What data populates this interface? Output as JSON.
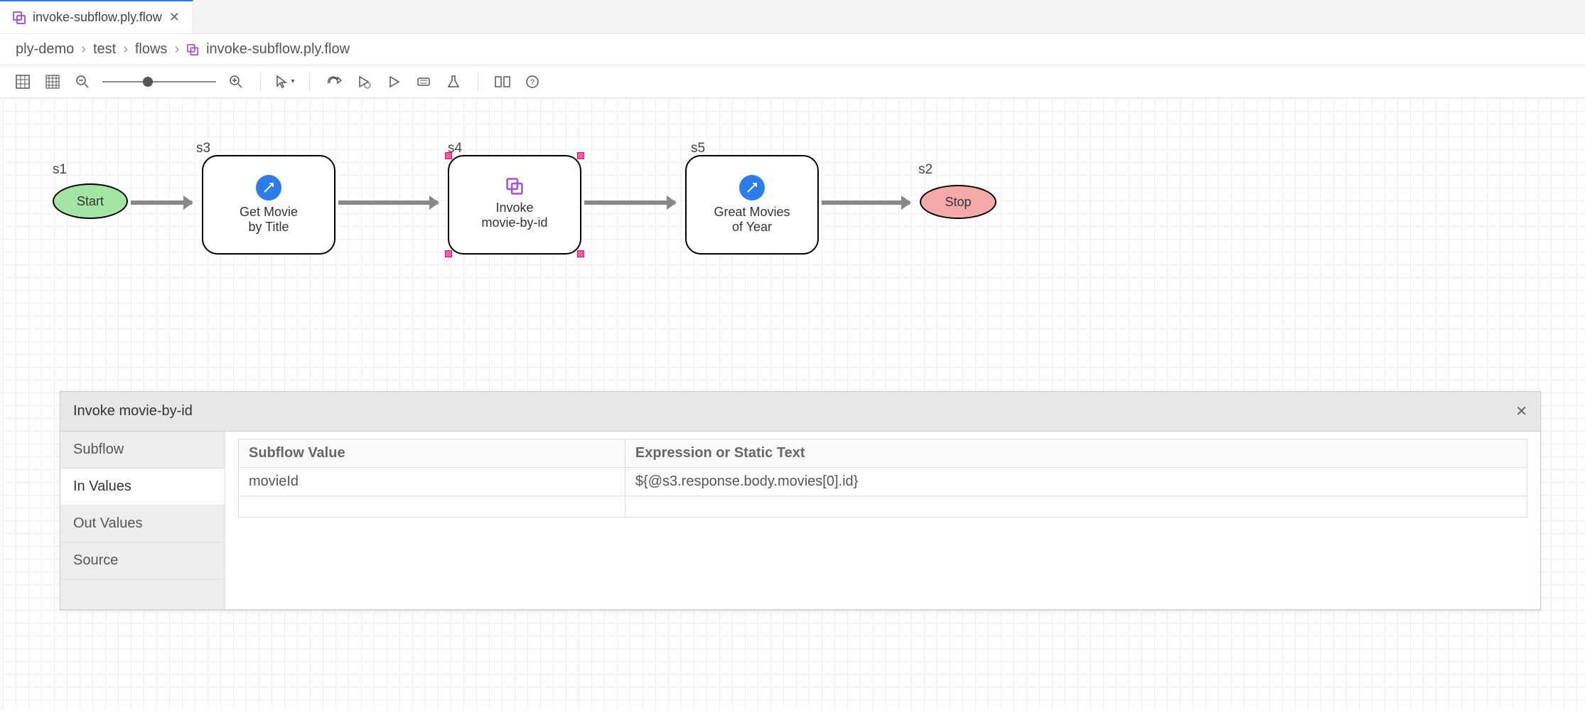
{
  "tab": {
    "title": "invoke-subflow.ply.flow"
  },
  "breadcrumb": {
    "items": [
      "ply-demo",
      "test",
      "flows",
      "invoke-subflow.ply.flow"
    ]
  },
  "toolbar": {
    "grid_btn": "grid",
    "grid_dense_btn": "grid-dense",
    "zoom_out": "zoom-out",
    "zoom_in": "zoom-in",
    "select_mode": "select",
    "redo": "redo",
    "run": "run",
    "play": "play",
    "form": "form",
    "flask": "flask",
    "compare": "compare",
    "help": "help"
  },
  "nodes": {
    "s1": {
      "id": "s1",
      "label": "Start"
    },
    "s2": {
      "id": "s2",
      "label": "Stop"
    },
    "s3": {
      "id": "s3",
      "title1": "Get Movie",
      "title2": "by Title"
    },
    "s4": {
      "id": "s4",
      "title1": "Invoke",
      "title2": "movie-by-id"
    },
    "s5": {
      "id": "s5",
      "title1": "Great Movies",
      "title2": "of Year"
    }
  },
  "panel": {
    "title": "Invoke movie-by-id",
    "tabs": [
      "Subflow",
      "In Values",
      "Out Values",
      "Source"
    ],
    "active_tab": "In Values",
    "grid": {
      "headers": [
        "Subflow Value",
        "Expression or Static Text"
      ],
      "rows": [
        {
          "key": "movieId",
          "value": "${@s3.response.body.movies[0].id}"
        }
      ]
    }
  }
}
